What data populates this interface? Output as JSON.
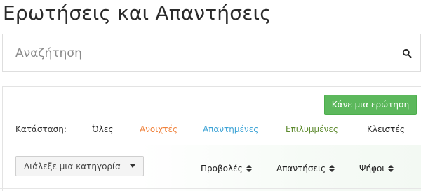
{
  "header": {
    "title": "Ερωτήσεις και Απαντήσεις"
  },
  "search": {
    "placeholder": "Αναζήτηση",
    "value": "",
    "icon": "search-icon"
  },
  "toolbar": {
    "ask_label": "Κάνε μια ερώτηση",
    "ask_color": "#5cb85c"
  },
  "filters": {
    "label": "Κατάσταση:",
    "items": [
      {
        "label": "Όλες",
        "color": "#222222",
        "active": true
      },
      {
        "label": "Ανοιχτές",
        "color": "#f0823c"
      },
      {
        "label": "Απαντημένες",
        "color": "#3fa4d6"
      },
      {
        "label": "Επιλυμμένες",
        "color": "#5d8a2e"
      },
      {
        "label": "Κλειστές",
        "color": "#222222"
      }
    ]
  },
  "category": {
    "selected": "Διάλεξε μια κατηγορία"
  },
  "sort": {
    "columns": [
      {
        "label": "Προβολές",
        "icon": "sort-icon"
      },
      {
        "label": "Απαντήσεις",
        "icon": "sort-icon"
      },
      {
        "label": "Ψήφοι",
        "icon": "sort-icon"
      }
    ]
  }
}
